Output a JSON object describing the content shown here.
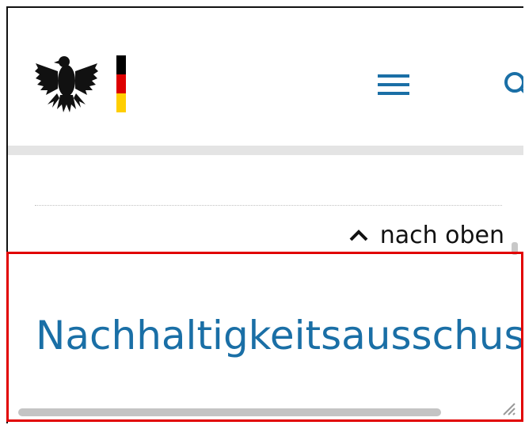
{
  "header": {
    "logo_alt": "Bundesadler",
    "flag_colors": [
      "#000000",
      "#dd0000",
      "#ffce00"
    ],
    "menu_icon": "hamburger-menu-icon",
    "search_icon": "search-icon",
    "accent_color": "#1a6fa6"
  },
  "back_to_top": {
    "label": "nach oben",
    "icon": "chevron-up-icon"
  },
  "section": {
    "heading": "Nachhaltigkeitsausschuss"
  },
  "highlight_color": "#e10000"
}
